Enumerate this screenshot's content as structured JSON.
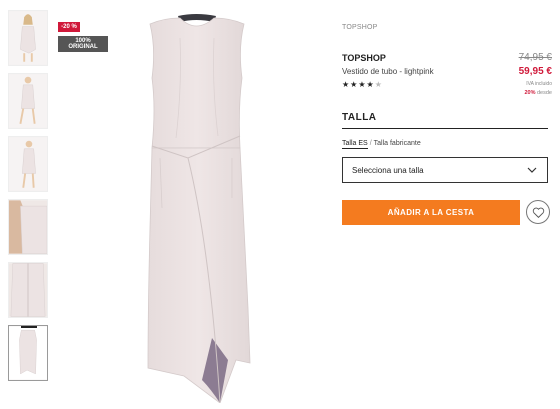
{
  "badges": {
    "discount": "-20 %",
    "original": "100% ORIGINAL"
  },
  "thumbnails": [
    {
      "icon": "dress-model-front"
    },
    {
      "icon": "dress-model-walk"
    },
    {
      "icon": "dress-model-side"
    },
    {
      "icon": "dress-detail"
    },
    {
      "icon": "dress-back-zip"
    },
    {
      "icon": "dress-flat"
    }
  ],
  "product": {
    "brand_top": "TOPSHOP",
    "brand": "TOPSHOP",
    "name": "Vestido de tubo - lightpink",
    "rating_filled": 4,
    "rating_total": 5,
    "stars_filled": "★★★★",
    "stars_empty": "★",
    "old_price": "74,95 €",
    "new_price": "59,95 €",
    "vat": "IVA incluido",
    "discount_pct": "20%",
    "discount_suffix": "desde"
  },
  "size": {
    "title": "TALLA",
    "tab_es": "Talla ES",
    "separator": "/",
    "tab_maker": "Talla fabricante",
    "select_placeholder": "Selecciona una talla"
  },
  "actions": {
    "add_to_cart": "AÑADIR A LA CESTA"
  },
  "colors": {
    "accent": "#f47b1f",
    "sale": "#d0193a",
    "dress": "#ece3e3"
  }
}
